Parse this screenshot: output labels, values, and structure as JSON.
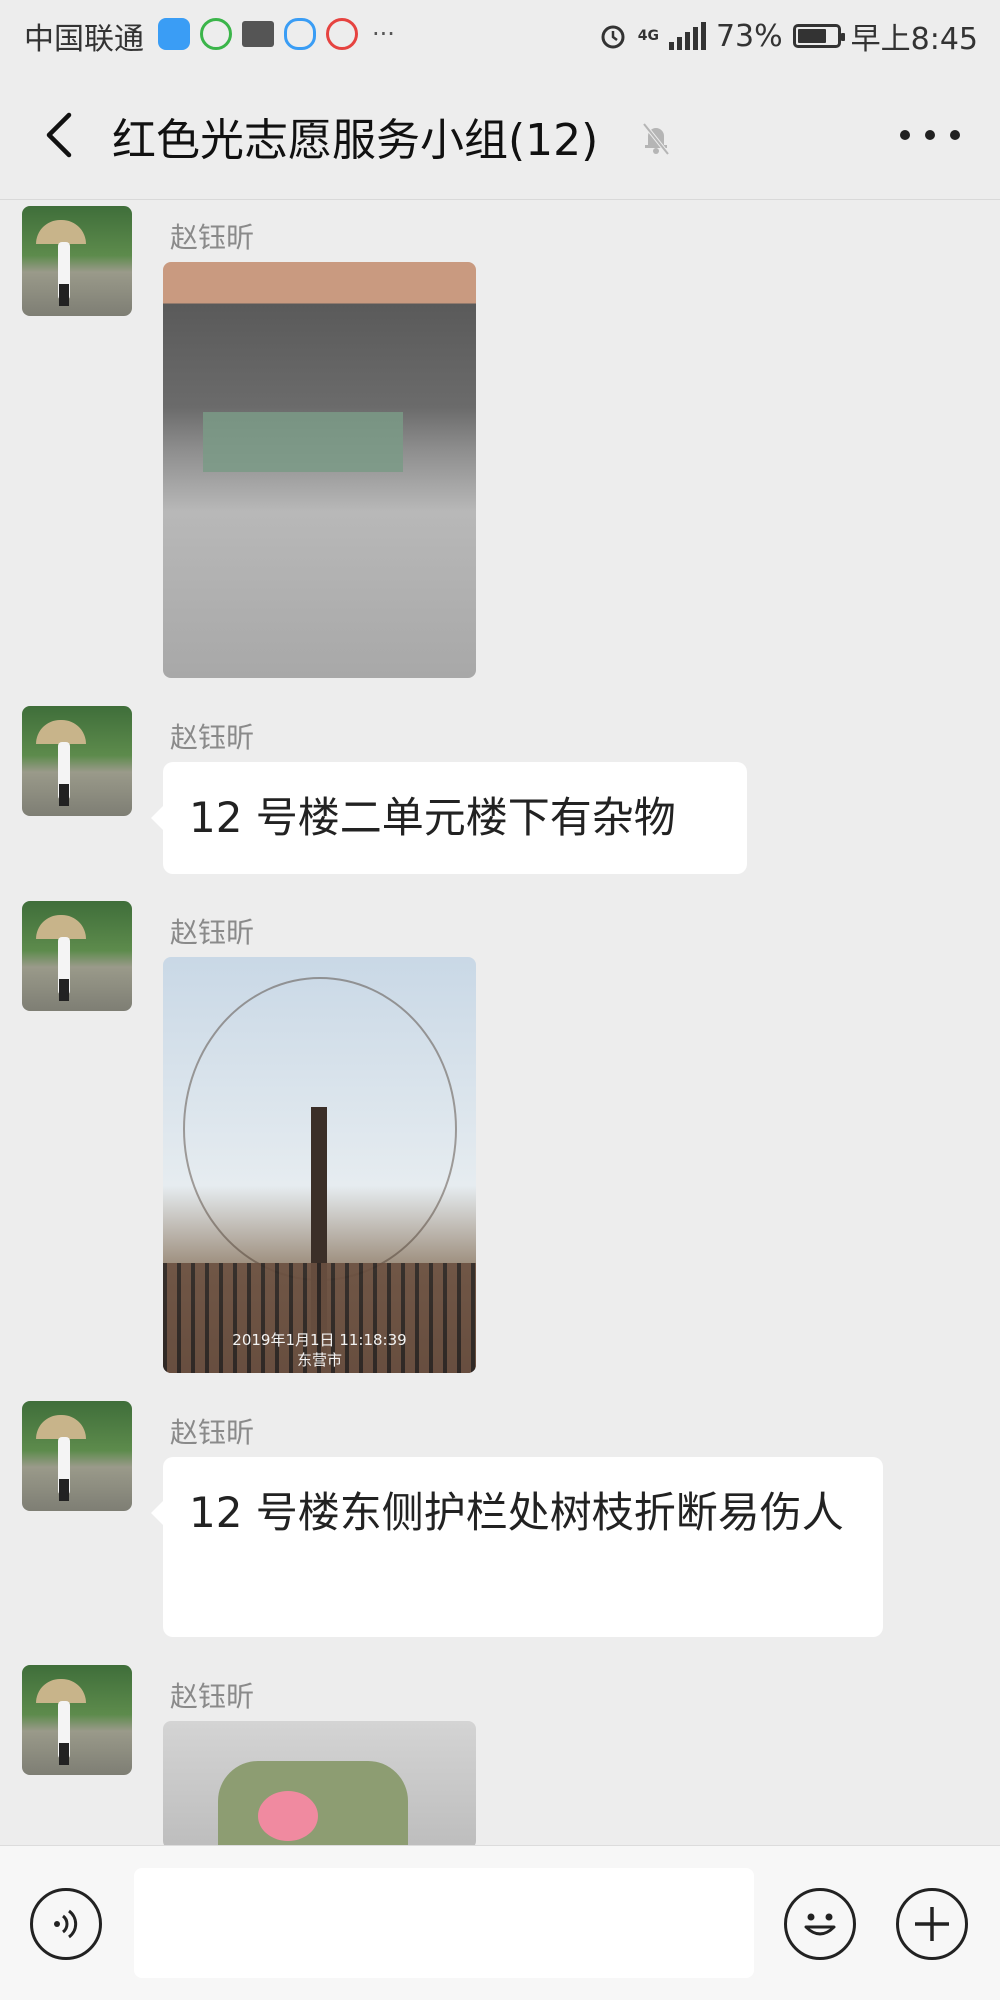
{
  "status_bar": {
    "carrier": "中国联通",
    "notification_icons": [
      "baidu-icon",
      "wechat-mini-icon",
      "mail-icon",
      "qq-icon",
      "weibo-icon"
    ],
    "more": "···",
    "network": "4G",
    "battery_percent": "73%",
    "battery_level": 0.73,
    "time": "早上8:45"
  },
  "header": {
    "title": "红色光志愿服务小组(12)",
    "back_icon": "chevron-left-icon",
    "mute_icon": "bell-off-icon",
    "more_icon": "more-icon"
  },
  "messages": [
    {
      "sender": "赵钰昕",
      "type": "image",
      "stamp": ""
    },
    {
      "sender": "赵钰昕",
      "type": "text",
      "text": "12 号楼二单元楼下有杂物"
    },
    {
      "sender": "赵钰昕",
      "type": "image",
      "stamp": "2019年1月1日 11:18:39",
      "stamp_place": "东营市"
    },
    {
      "sender": "赵钰昕",
      "type": "text",
      "text": "12 号楼东侧护栏处树枝折断易伤人"
    },
    {
      "sender": "赵钰昕",
      "type": "image",
      "stamp": ""
    }
  ],
  "input_bar": {
    "voice_icon": "voice-icon",
    "input_value": "",
    "emoji_icon": "emoji-icon",
    "plus_icon": "plus-icon"
  }
}
